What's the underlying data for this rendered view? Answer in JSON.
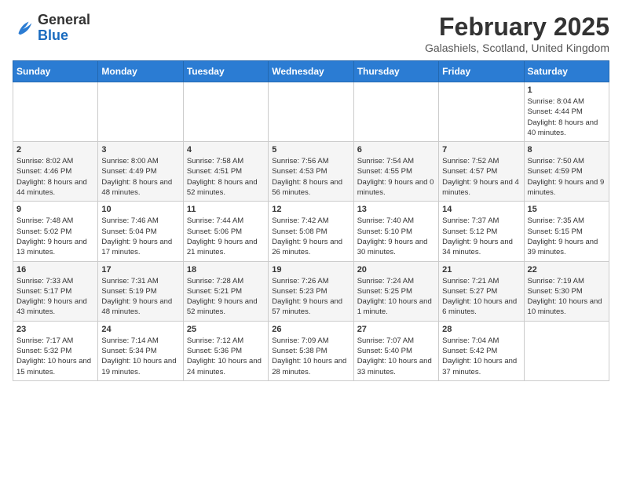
{
  "header": {
    "logo_general": "General",
    "logo_blue": "Blue",
    "month_title": "February 2025",
    "location": "Galashiels, Scotland, United Kingdom"
  },
  "days_of_week": [
    "Sunday",
    "Monday",
    "Tuesday",
    "Wednesday",
    "Thursday",
    "Friday",
    "Saturday"
  ],
  "weeks": [
    [
      {
        "day": "",
        "info": ""
      },
      {
        "day": "",
        "info": ""
      },
      {
        "day": "",
        "info": ""
      },
      {
        "day": "",
        "info": ""
      },
      {
        "day": "",
        "info": ""
      },
      {
        "day": "",
        "info": ""
      },
      {
        "day": "1",
        "info": "Sunrise: 8:04 AM\nSunset: 4:44 PM\nDaylight: 8 hours and 40 minutes."
      }
    ],
    [
      {
        "day": "2",
        "info": "Sunrise: 8:02 AM\nSunset: 4:46 PM\nDaylight: 8 hours and 44 minutes."
      },
      {
        "day": "3",
        "info": "Sunrise: 8:00 AM\nSunset: 4:49 PM\nDaylight: 8 hours and 48 minutes."
      },
      {
        "day": "4",
        "info": "Sunrise: 7:58 AM\nSunset: 4:51 PM\nDaylight: 8 hours and 52 minutes."
      },
      {
        "day": "5",
        "info": "Sunrise: 7:56 AM\nSunset: 4:53 PM\nDaylight: 8 hours and 56 minutes."
      },
      {
        "day": "6",
        "info": "Sunrise: 7:54 AM\nSunset: 4:55 PM\nDaylight: 9 hours and 0 minutes."
      },
      {
        "day": "7",
        "info": "Sunrise: 7:52 AM\nSunset: 4:57 PM\nDaylight: 9 hours and 4 minutes."
      },
      {
        "day": "8",
        "info": "Sunrise: 7:50 AM\nSunset: 4:59 PM\nDaylight: 9 hours and 9 minutes."
      }
    ],
    [
      {
        "day": "9",
        "info": "Sunrise: 7:48 AM\nSunset: 5:02 PM\nDaylight: 9 hours and 13 minutes."
      },
      {
        "day": "10",
        "info": "Sunrise: 7:46 AM\nSunset: 5:04 PM\nDaylight: 9 hours and 17 minutes."
      },
      {
        "day": "11",
        "info": "Sunrise: 7:44 AM\nSunset: 5:06 PM\nDaylight: 9 hours and 21 minutes."
      },
      {
        "day": "12",
        "info": "Sunrise: 7:42 AM\nSunset: 5:08 PM\nDaylight: 9 hours and 26 minutes."
      },
      {
        "day": "13",
        "info": "Sunrise: 7:40 AM\nSunset: 5:10 PM\nDaylight: 9 hours and 30 minutes."
      },
      {
        "day": "14",
        "info": "Sunrise: 7:37 AM\nSunset: 5:12 PM\nDaylight: 9 hours and 34 minutes."
      },
      {
        "day": "15",
        "info": "Sunrise: 7:35 AM\nSunset: 5:15 PM\nDaylight: 9 hours and 39 minutes."
      }
    ],
    [
      {
        "day": "16",
        "info": "Sunrise: 7:33 AM\nSunset: 5:17 PM\nDaylight: 9 hours and 43 minutes."
      },
      {
        "day": "17",
        "info": "Sunrise: 7:31 AM\nSunset: 5:19 PM\nDaylight: 9 hours and 48 minutes."
      },
      {
        "day": "18",
        "info": "Sunrise: 7:28 AM\nSunset: 5:21 PM\nDaylight: 9 hours and 52 minutes."
      },
      {
        "day": "19",
        "info": "Sunrise: 7:26 AM\nSunset: 5:23 PM\nDaylight: 9 hours and 57 minutes."
      },
      {
        "day": "20",
        "info": "Sunrise: 7:24 AM\nSunset: 5:25 PM\nDaylight: 10 hours and 1 minute."
      },
      {
        "day": "21",
        "info": "Sunrise: 7:21 AM\nSunset: 5:27 PM\nDaylight: 10 hours and 6 minutes."
      },
      {
        "day": "22",
        "info": "Sunrise: 7:19 AM\nSunset: 5:30 PM\nDaylight: 10 hours and 10 minutes."
      }
    ],
    [
      {
        "day": "23",
        "info": "Sunrise: 7:17 AM\nSunset: 5:32 PM\nDaylight: 10 hours and 15 minutes."
      },
      {
        "day": "24",
        "info": "Sunrise: 7:14 AM\nSunset: 5:34 PM\nDaylight: 10 hours and 19 minutes."
      },
      {
        "day": "25",
        "info": "Sunrise: 7:12 AM\nSunset: 5:36 PM\nDaylight: 10 hours and 24 minutes."
      },
      {
        "day": "26",
        "info": "Sunrise: 7:09 AM\nSunset: 5:38 PM\nDaylight: 10 hours and 28 minutes."
      },
      {
        "day": "27",
        "info": "Sunrise: 7:07 AM\nSunset: 5:40 PM\nDaylight: 10 hours and 33 minutes."
      },
      {
        "day": "28",
        "info": "Sunrise: 7:04 AM\nSunset: 5:42 PM\nDaylight: 10 hours and 37 minutes."
      },
      {
        "day": "",
        "info": ""
      }
    ]
  ]
}
